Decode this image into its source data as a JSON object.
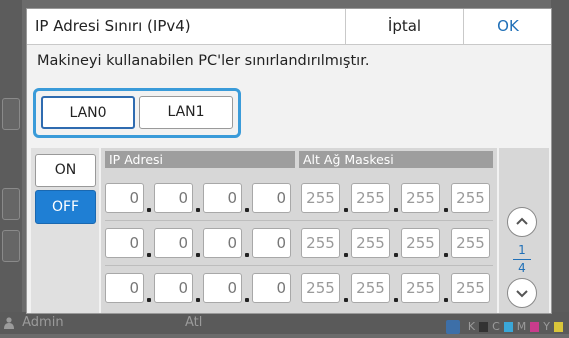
{
  "dialog": {
    "title": "IP Adresi Sınırı (IPv4)",
    "cancel_label": "İptal",
    "ok_label": "OK",
    "message": "Makineyi kullanabilen PC'ler sınırlandırılmıştır."
  },
  "lan_tabs": [
    {
      "label": "LAN0",
      "selected": true
    },
    {
      "label": "LAN1",
      "selected": false
    }
  ],
  "toggle": {
    "on_label": "ON",
    "off_label": "OFF",
    "selected": "OFF"
  },
  "table": {
    "ip_header": "IP Adresi",
    "mask_header": "Alt Ağ Maskesi",
    "rows": [
      {
        "ip": [
          "0",
          "0",
          "0",
          "0"
        ],
        "mask": [
          "255",
          "255",
          "255",
          "255"
        ]
      },
      {
        "ip": [
          "0",
          "0",
          "0",
          "0"
        ],
        "mask": [
          "255",
          "255",
          "255",
          "255"
        ]
      },
      {
        "ip": [
          "0",
          "0",
          "0",
          "0"
        ],
        "mask": [
          "255",
          "255",
          "255",
          "255"
        ]
      }
    ]
  },
  "pager": {
    "current": "1",
    "total": "4"
  },
  "background": {
    "user": "Admin",
    "center_text": "Atl",
    "ink_labels": [
      "K",
      "C",
      "M",
      "Y"
    ]
  },
  "colors": {
    "accent": "#1f7fd4",
    "focus": "#3a9bd9",
    "link": "#1f6fb7"
  },
  "icons": {
    "scroll_up": "chevron-up-icon",
    "scroll_down": "chevron-down-icon",
    "user": "user-icon",
    "edit": "edit-icon"
  }
}
